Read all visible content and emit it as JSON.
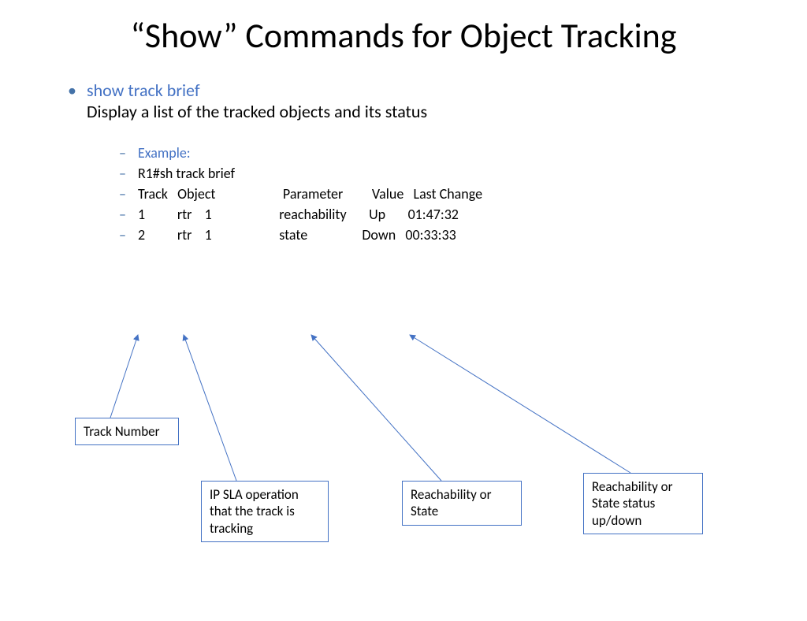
{
  "title": "“Show” Commands for Object Tracking",
  "command": "show track brief",
  "description": "Display a list of the tracked objects and its status",
  "example_label": "Example:",
  "lines": {
    "l0": "R1#sh track brief",
    "l1": "Track   Object                     Parameter         Value   Last Change",
    "l2": "1          rtr    1                     reachability       Up       01:47:32",
    "l3": "2          rtr    1                     state                 Down   00:33:33"
  },
  "callouts": {
    "c1": "Track Number",
    "c2": "IP SLA operation that the track is tracking",
    "c3": "Reachability or State",
    "c4": "Reachability or State status up/down"
  }
}
